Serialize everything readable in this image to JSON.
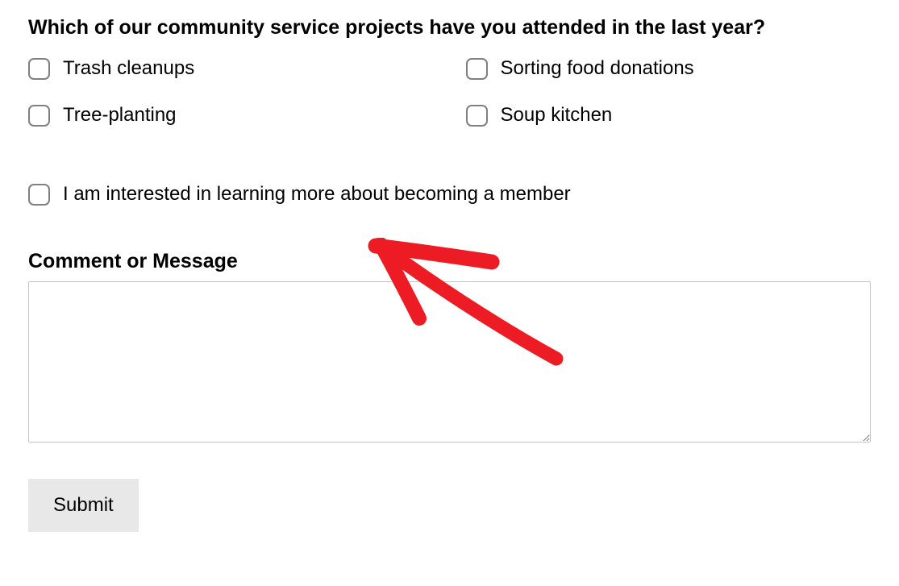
{
  "question": "Which of our community service projects have you attended in the last year?",
  "options": [
    {
      "label": "Trash cleanups"
    },
    {
      "label": "Sorting food donations"
    },
    {
      "label": "Tree-planting"
    },
    {
      "label": "Soup kitchen"
    }
  ],
  "interest": {
    "label": "I am interested in learning more about becoming a member"
  },
  "comment": {
    "label": "Comment or Message"
  },
  "submit": {
    "label": "Submit"
  },
  "annotation": {
    "color": "#ed1c24"
  }
}
